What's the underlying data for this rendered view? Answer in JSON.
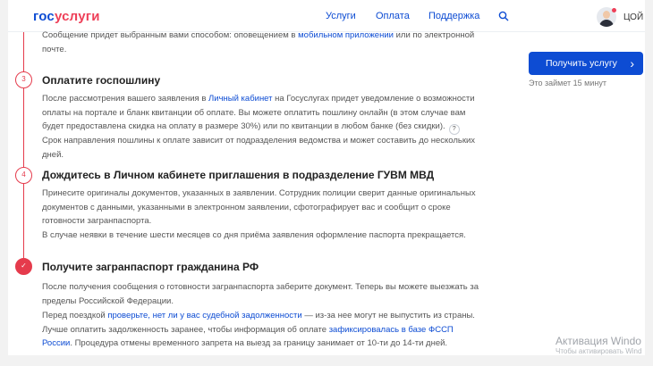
{
  "header": {
    "logo_part1": "гос",
    "logo_part2": "услуги",
    "nav": [
      "Услуги",
      "Оплата",
      "Поддержка"
    ],
    "search_icon": "search-icon",
    "user_label": "ЦОЙ"
  },
  "intro": {
    "pre": "Сообщение придет выбранным вами способом: оповещением в ",
    "link": "мобильном приложении",
    "post1": " или по электронной",
    "post2": "почте."
  },
  "step3": {
    "number": "3",
    "title": "Оплатите госпошлину",
    "p1_pre": "После рассмотрения вашего заявления в ",
    "p1_link": "Личный кабинет",
    "p1_post": " на Госуслугах придет уведомление о возможности",
    "p1_line2": "оплаты на портале и бланк квитанции об оплате. Вы можете оплатить пошлину онлайн (в этом случае вам",
    "p1_line3": "будет предоставлена скидка на оплату в размере 30%) или по квитанции в любом банке (без скидки).",
    "help": "?",
    "p2_line1": "Срок направления пошлины к оплате зависит от подразделения ведомства и может составить до нескольких",
    "p2_line2": "дней."
  },
  "step4": {
    "number": "4",
    "title": "Дождитесь в Личном кабинете приглашения в подразделение ГУВМ МВД",
    "p1_line1": "Принесите оригиналы документов, указанных в заявлении. Сотрудник полиции сверит данные оригинальных",
    "p1_line2": "документов с данными, указанными в электронном заявлении, сфотографирует вас и сообщит о сроке",
    "p1_line3": "готовности загранпаспорта.",
    "p2": "В случае неявки в течение шести месяцев со дня приёма заявления оформление паспорта прекращается."
  },
  "step5": {
    "check": "✓",
    "title": "Получите загранпаспорт гражданина РФ",
    "p1_line1": "После получения сообщения о готовности загранпаспорта заберите документ. Теперь вы можете выезжать за",
    "p1_line2": "пределы Российской Федерации.",
    "p2_pre": "Перед поездкой ",
    "p2_link": "проверьте, нет ли у вас судебной задолженности",
    "p2_post": " — из-за нее могут не выпустить из страны.",
    "p3_pre": "Лучше оплатить задолженность заранее, чтобы информация об оплате ",
    "p3_link1": "зафиксировалась в базе ФССП",
    "p3_link2": "России",
    "p3_post": ". Процедура отмены временного запрета на выезд за границу занимает от 10-ти до 14-ти дней."
  },
  "sidebar": {
    "button_label": "Получить услугу",
    "note": "Это займет 15 минут"
  },
  "watermark": {
    "line1": "Активация Windo",
    "line2": "Чтобы активировать Wind"
  }
}
